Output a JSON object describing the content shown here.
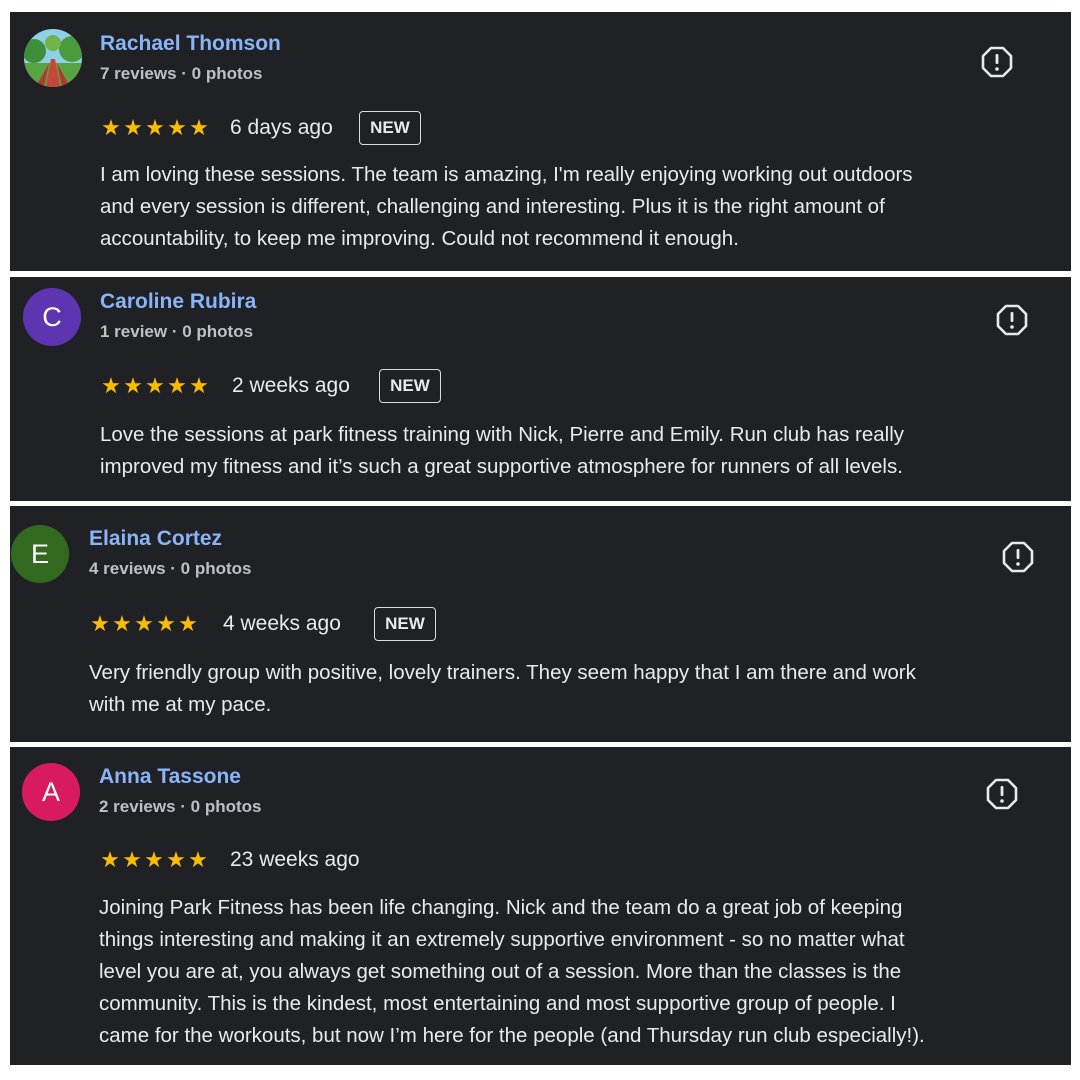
{
  "colors": {
    "card_background": "#202124",
    "name_link": "#8ab4f8",
    "star": "#fbbc04",
    "avatar_caroline": "#5e35b1",
    "avatar_elaina": "#33691e",
    "avatar_anna": "#d81b60"
  },
  "icons": {
    "flag": "report-flag-icon",
    "star": "star-icon"
  },
  "reviews": [
    {
      "name": "Rachael Thomson",
      "avatar": "photo",
      "meta": "7 reviews · 0 photos",
      "rating": 5,
      "stars": "★★★★★",
      "time": "6 days ago",
      "badge": "NEW",
      "lines": [
        "I am loving these sessions. The team is amazing, I'm really enjoying working out outdoors",
        "and every session is different, challenging and interesting. Plus it is the right amount of",
        "accountability, to keep me improving. Could not recommend it enough."
      ]
    },
    {
      "name": "Caroline Rubira",
      "avatar": "C",
      "meta": "1 review · 0 photos",
      "rating": 5,
      "stars": "★★★★★",
      "time": "2 weeks ago",
      "badge": "NEW",
      "lines": [
        "Love the sessions at park fitness training with Nick, Pierre and Emily. Run club has really",
        "improved my fitness and it’s such a great supportive atmosphere for runners of all levels."
      ]
    },
    {
      "name": "Elaina Cortez",
      "avatar": "E",
      "meta": "4 reviews · 0 photos",
      "rating": 5,
      "stars": "★★★★★",
      "time": "4 weeks ago",
      "badge": "NEW",
      "lines": [
        "Very friendly group with positive, lovely trainers. They seem happy that I am there and work",
        "with me at my pace."
      ]
    },
    {
      "name": "Anna Tassone",
      "avatar": "A",
      "meta": "2 reviews · 0 photos",
      "rating": 5,
      "stars": "★★★★★",
      "time": "23 weeks ago",
      "lines": [
        "Joining Park Fitness has been life changing. Nick and the team do a great job of keeping",
        "things interesting and making it an extremely supportive environment - so no matter what",
        "level you are at, you always get something out of a session. More than the classes is the",
        "community. This is the kindest, most entertaining and most supportive group of people. I",
        "came for the workouts, but now I’m here for the people (and Thursday run club especially!)."
      ]
    }
  ]
}
